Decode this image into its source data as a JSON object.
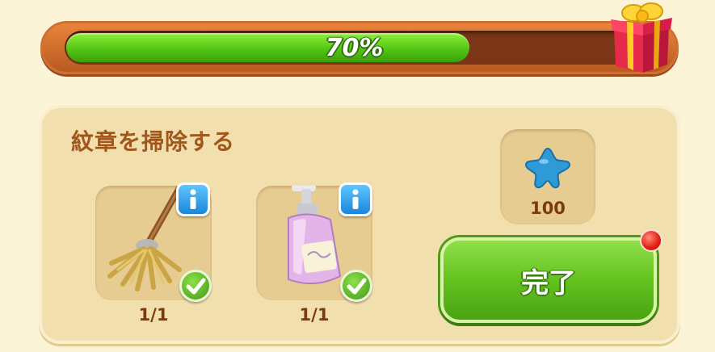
{
  "progress": {
    "percent_label": "70%",
    "fraction": 0.7,
    "fill_color": "#55c514",
    "frame_color": "#e8843c"
  },
  "gift": {
    "icon": "gift-box-icon"
  },
  "quest": {
    "title": "紋章を掃除する",
    "items": [
      {
        "name": "mop",
        "icon": "mop-icon",
        "count": "1/1",
        "completed": true
      },
      {
        "name": "soap",
        "icon": "soap-bottle-icon",
        "count": "1/1",
        "completed": true
      }
    ],
    "reward": {
      "icon": "blue-star-icon",
      "amount": "100",
      "color": "#2f9bd6"
    },
    "complete_button": {
      "label": "完了",
      "color": "#64c21f"
    },
    "notification": {
      "color": "#e01d12"
    }
  }
}
